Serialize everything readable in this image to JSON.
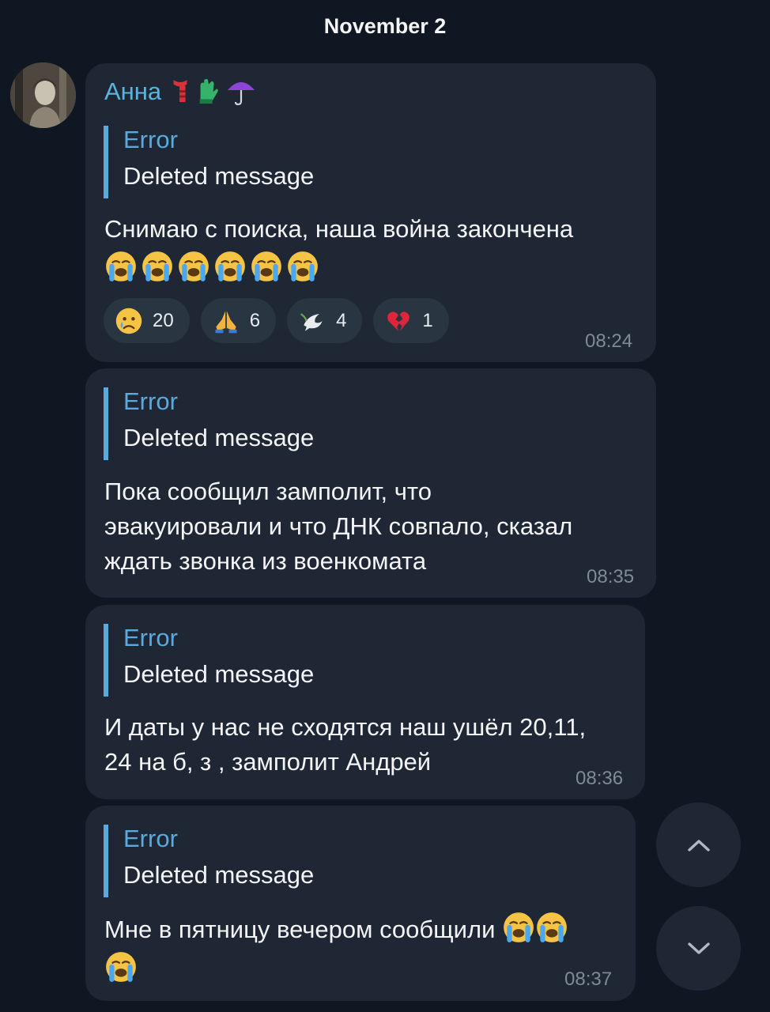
{
  "date_chip": "November 2",
  "sender": {
    "name": "Анна",
    "emoji_icons": [
      "scarf-icon",
      "gloves-icon",
      "umbrella-icon"
    ]
  },
  "messages": [
    {
      "reply": {
        "title": "Error",
        "text": "Deleted message"
      },
      "text_lines": [
        "Снимаю с поиска, наша война закончена"
      ],
      "emoji_count": 6,
      "emoji_icon": "loudly-crying-face-icon",
      "reactions": [
        {
          "icon": "crying-face-icon",
          "count": "20"
        },
        {
          "icon": "folded-hands-icon",
          "count": "6"
        },
        {
          "icon": "dove-icon",
          "count": "4"
        },
        {
          "icon": "broken-heart-icon",
          "count": "1"
        }
      ],
      "time": "08:24"
    },
    {
      "reply": {
        "title": "Error",
        "text": "Deleted message"
      },
      "text_lines": [
        "Пока сообщил замполит, что",
        "эвакуировали и что ДНК совпало, сказал",
        "ждать звонка из военкомата"
      ],
      "time": "08:35"
    },
    {
      "reply": {
        "title": "Error",
        "text": "Deleted message"
      },
      "text_lines": [
        "И даты у нас не сходятся наш ушёл 20,11,",
        "24 на б, з , замполит Андрей"
      ],
      "time": "08:36"
    },
    {
      "reply": {
        "title": "Error",
        "text": "Deleted message"
      },
      "text_lines": [
        "Мне в пятницу вечером сообщили"
      ],
      "emoji_icon": "loudly-crying-face-icon",
      "time": "08:37"
    }
  ],
  "buttons": {
    "scroll_up_icon": "chevron-up-icon",
    "scroll_down_icon": "chevron-down-icon"
  },
  "colors": {
    "background": "#0f1822",
    "bubble": "#1e2733",
    "accent": "#5aa9df",
    "sender_name": "#59b4e0",
    "timestamp": "#7e8a97"
  }
}
